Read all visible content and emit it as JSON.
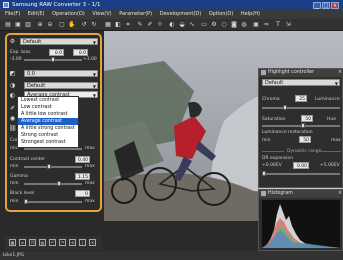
{
  "window": {
    "title": "Samsung RAW Converter 3 - 1/1",
    "controls": [
      "_",
      "□",
      "×"
    ]
  },
  "menu": [
    "File(F)",
    "Edit(E)",
    "Operation(O)",
    "View(V)",
    "Parameter(P)",
    "Development(D)",
    "Option(O)",
    "Help(H)"
  ],
  "left_panel": {
    "preset": "Default",
    "exp_bias_label": "Exp. bias",
    "exp_bias_value": "0.0",
    "exp_bias_value2": "0.0",
    "exp_min": "-3.00",
    "exp_max": "+3.00",
    "wb_value": "0.0",
    "tone_preset": "Default",
    "contrast_select": "Average contrast",
    "contrast_options": [
      "Lowest contrast",
      "Low contrast",
      "A little low contrast",
      "Average contrast",
      "A little strong contrast",
      "Strong contrast",
      "Strongest contrast"
    ],
    "contrast_label": "Contrast",
    "min_label": "min",
    "max_label": "max",
    "contrast_center_label": "Contrast center",
    "contrast_center_value": "0.40",
    "gamma_label": "Gamma",
    "gamma_value": "1.15",
    "black_level_label": "Black level",
    "black_level_value": "0"
  },
  "highlight_panel": {
    "title": "Highlight controller",
    "preset": "Default",
    "chroma_label": "Chroma",
    "chroma_value": "25",
    "luminance_label": "Luminance",
    "saturation_label": "Saturation",
    "saturation_value": "50",
    "hue_label": "Hue",
    "lum_restoration_label": "Luminance restoration",
    "min_label": "min",
    "lum_restoration_value": "50",
    "max_label": "max",
    "dynamic_range_label": "Dynamic range",
    "dr_exp_label": "DR expansion",
    "dr_left": "+0.00EV",
    "dr_value": "0.00",
    "dr_right": "+5.00EV"
  },
  "histogram_panel": {
    "title": "Histogram"
  },
  "status": {
    "filename": "bike1.JPG"
  }
}
